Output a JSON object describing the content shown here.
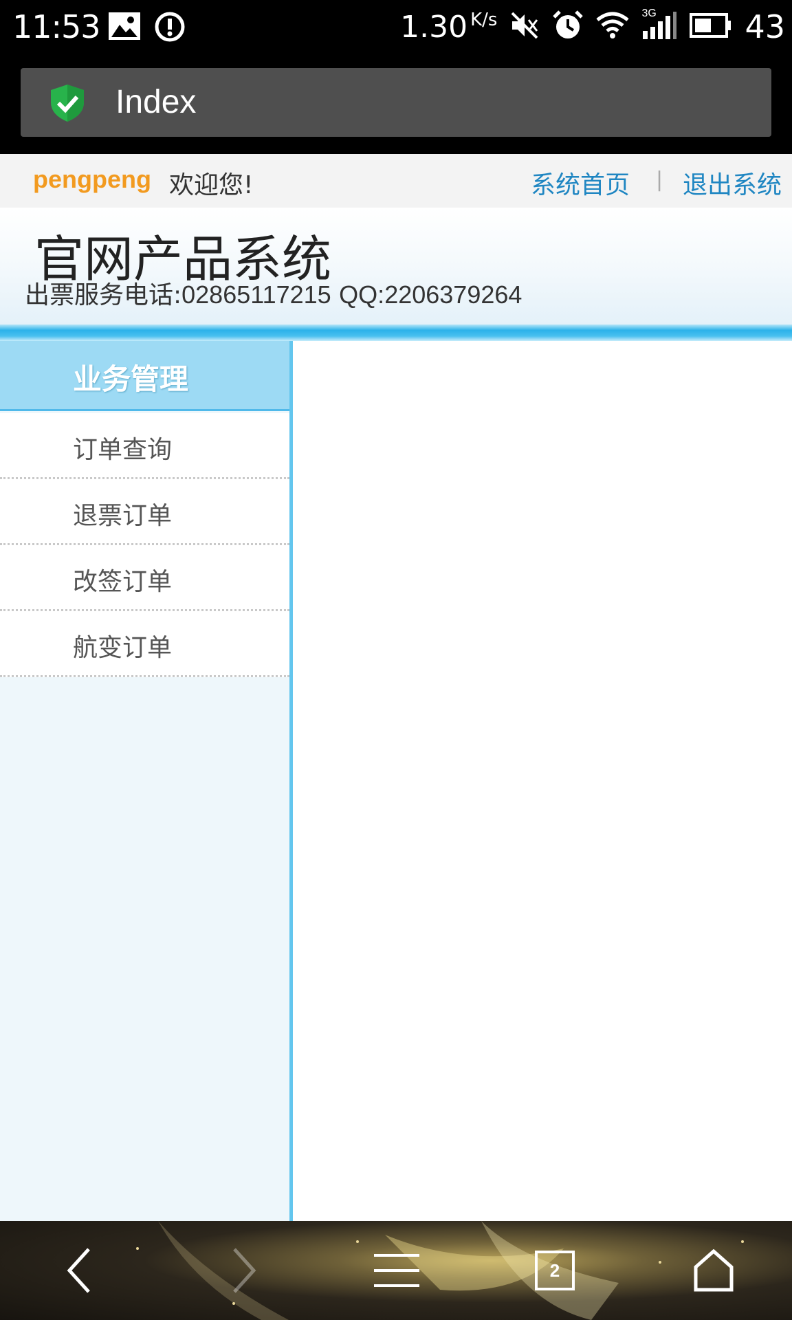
{
  "status_bar": {
    "time": "11:53",
    "speed": "1.30",
    "speed_unit": "K/s",
    "network": "3G",
    "battery": "43",
    "icons": [
      "image-icon",
      "alert-icon",
      "mute-icon",
      "alarm-icon",
      "wifi-icon",
      "signal-icon",
      "battery-icon"
    ]
  },
  "browser": {
    "page_title": "Index",
    "security_icon": "shield-check-icon",
    "tab_count": "2"
  },
  "topbar": {
    "username": "pengpeng",
    "welcome": "欢迎您!",
    "home_link": "系统首页",
    "separator": "|",
    "logout_link": "退出系统"
  },
  "header": {
    "title": "官网产品系统",
    "service_label": "出票服务电话:",
    "service_phone": "02865117215",
    "qq_label": "QQ:",
    "qq_number": "2206379264"
  },
  "sidebar": {
    "heading": "业务管理",
    "items": [
      {
        "label": "订单查询"
      },
      {
        "label": "退票订单"
      },
      {
        "label": "改签订单"
      },
      {
        "label": "航变订单"
      }
    ]
  },
  "colors": {
    "username": "#f29a1f",
    "link": "#1f86c2",
    "sidebar_head": "#9ddaf4",
    "sidebar_bg": "#eef7fb",
    "accent_band": "#2bb2ea"
  }
}
